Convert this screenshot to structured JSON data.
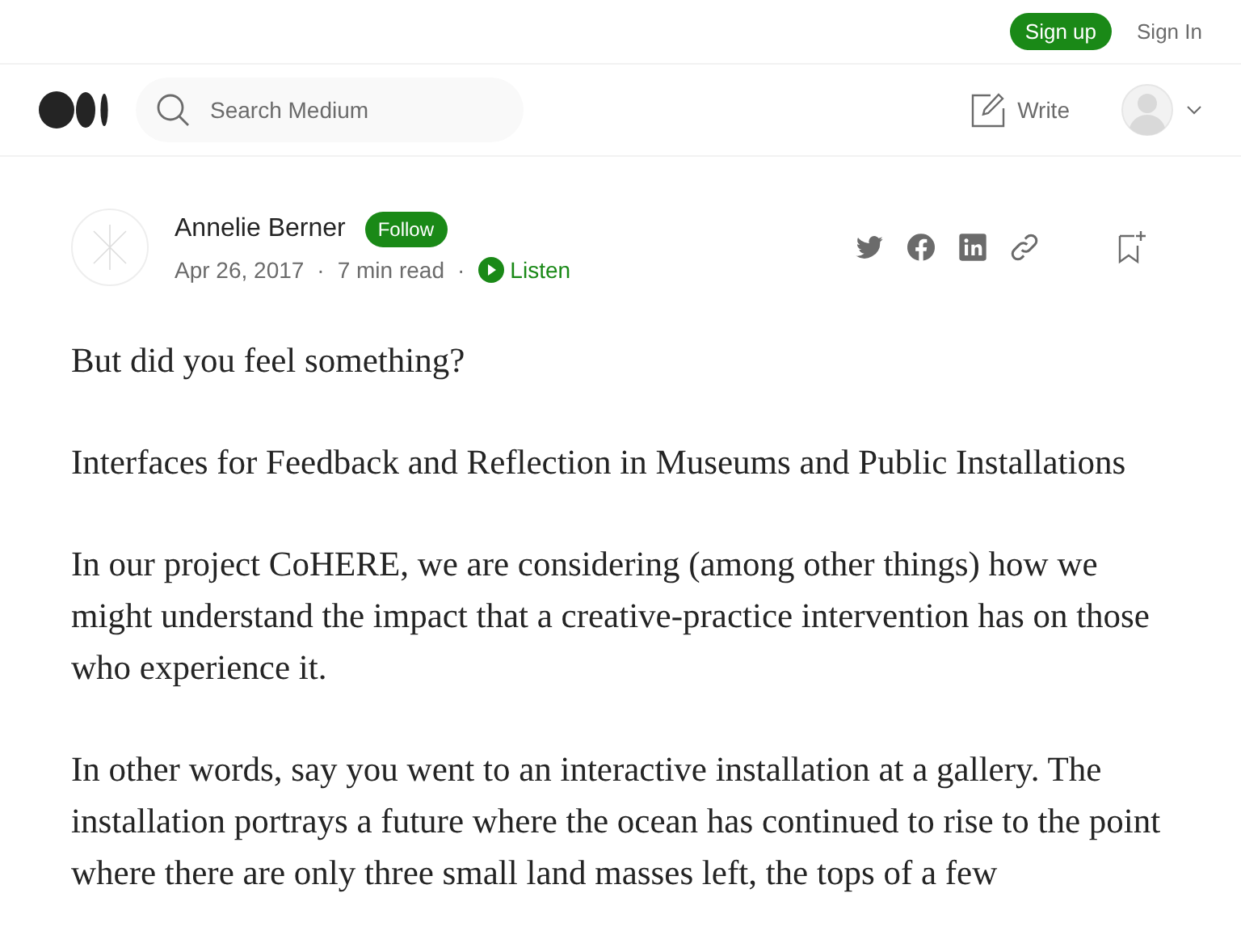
{
  "top_bar": {
    "signup_button": "Sign up",
    "signin_link": "Sign In"
  },
  "header": {
    "search": {
      "placeholder": "Search Medium"
    },
    "write_link": "Write"
  },
  "author": {
    "name": "Annelie Berner",
    "follow_button": "Follow",
    "date": "Apr 26, 2017",
    "separator_1": "·",
    "read_time": "7 min read",
    "separator_2": "·",
    "listen_button": "Listen"
  },
  "article": {
    "paragraphs": [
      "But did you feel something?",
      "Interfaces for Feedback and Reflection in Museums and Public Installations",
      "In our project CoHERE, we are considering (among other things) how we might understand the impact that a creative-practice intervention has on those who experience it.",
      "In other words, say you went to an interactive installation at a gallery. The installation portrays a future where the ocean has continued to rise to the point where there are only three small land masses left, the tops of a few"
    ]
  }
}
